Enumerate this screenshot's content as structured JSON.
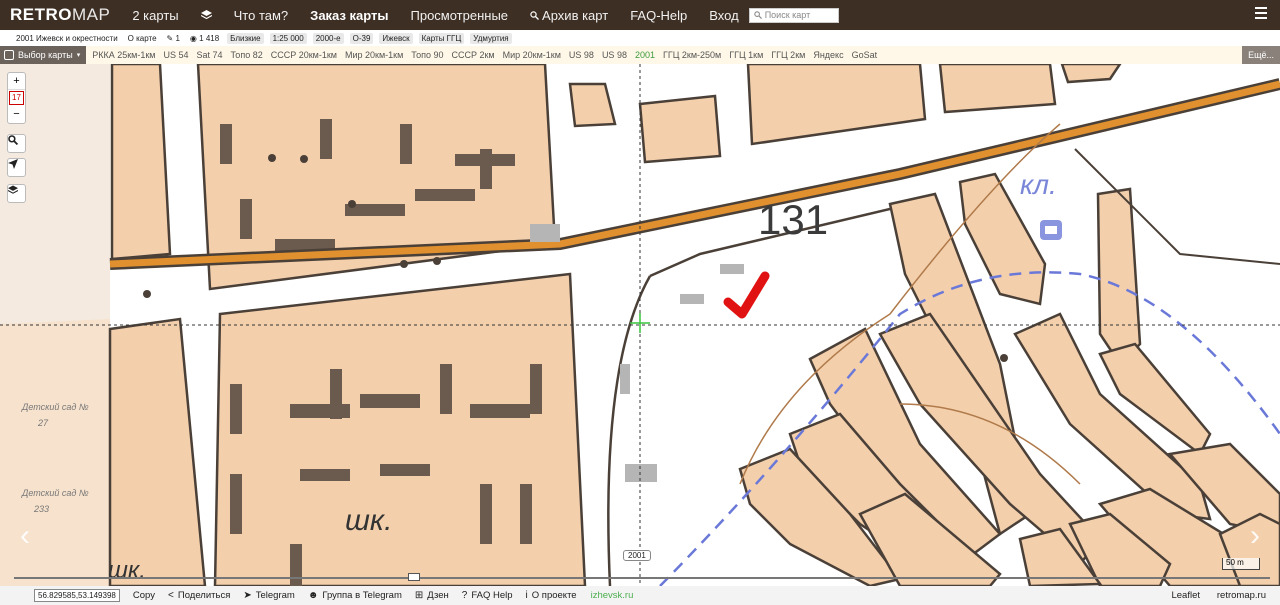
{
  "header": {
    "logo_retro": "RETRO",
    "logo_map": "MAP",
    "nav": [
      {
        "label": "2 карты",
        "icon": null
      },
      {
        "label": "",
        "icon": "layers-icon"
      },
      {
        "label": "Что там?",
        "icon": null
      },
      {
        "label": "Заказ карты",
        "icon": null,
        "active": true
      },
      {
        "label": "Просмотренные",
        "icon": null
      },
      {
        "label": "Архив карт",
        "icon": "search-icon"
      },
      {
        "label": "FAQ-Help",
        "icon": null
      },
      {
        "label": "Вход",
        "icon": null
      }
    ],
    "search_placeholder": "Поиск карт"
  },
  "infobar": {
    "map_name": "2001 Ижевск и окрестности",
    "about": "О карте",
    "edit_count": "1",
    "views": "1 418",
    "tags": [
      "Близкие",
      "1:25 000",
      "2000-е",
      "О-39",
      "Ижевск",
      "Карты ГГЦ",
      "Удмуртия"
    ]
  },
  "layerbar": {
    "select_label": "Выбор карты",
    "layers": [
      "РККА 25км-1км",
      "US 54",
      "Sat 74",
      "Топо 82",
      "СССР 20км-1км",
      "Мир 20км-1км",
      "Топо 90",
      "СССР 2км",
      "Мир 20км-1км",
      "US 98",
      "US 98",
      "2001",
      "ГГЦ 2км-250м",
      "ГГЦ 1км",
      "ГГЦ 2км",
      "Яндекс",
      "GoSat"
    ],
    "selected_layer": "2001",
    "more_label": "Ещё..."
  },
  "map": {
    "zoom_in": "+",
    "zoom_level": "17",
    "zoom_out": "−",
    "year_label": "2001",
    "scale_label": "50 m",
    "prev_arrow": "‹",
    "next_arrow": "›",
    "map_text": {
      "road_number": "131",
      "cemetery_label": "кл.",
      "school_label": "шк.",
      "school_label_2": "шк.",
      "kinder_1": "Детский сад №",
      "kinder_1_no": "27",
      "kinder_2": "Детский сад №",
      "kinder_2_no": "233"
    },
    "colors": {
      "block": "#f3cfac",
      "road": "#e0902f",
      "route_dashed": "#6a78d8",
      "marker": "#e11212"
    }
  },
  "footer": {
    "coords": "56.829585,53.149398",
    "copy": "Copy",
    "share": "Поделиться",
    "telegram": "Telegram",
    "telegram_group": "Группа в Telegram",
    "dzen": "Дзен",
    "faq": "FAQ Help",
    "about": "О проекте",
    "site": "izhevsk.ru",
    "leaflet": "Leaflet",
    "retromap": "retromap.ru"
  }
}
